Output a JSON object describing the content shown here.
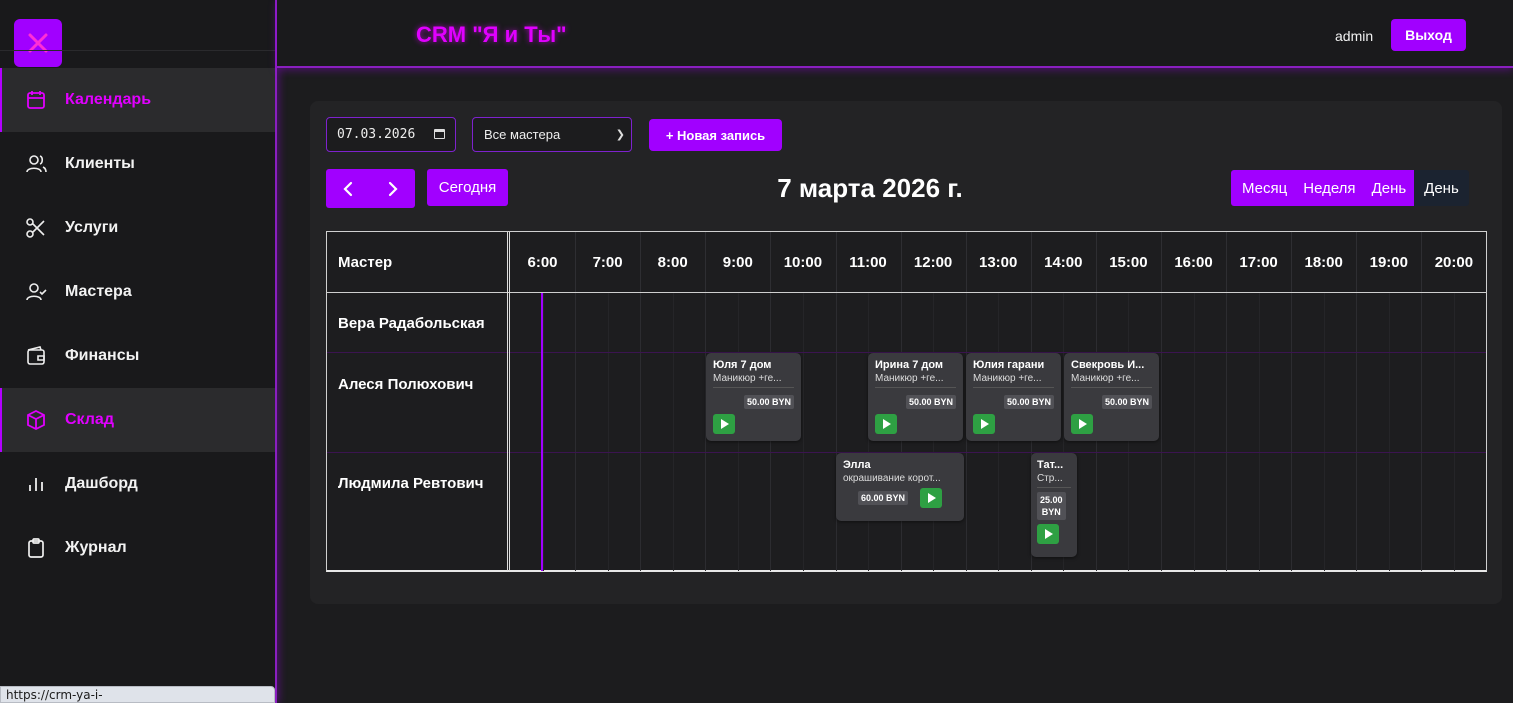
{
  "app": {
    "brand": "CRM \"Я и Ты\""
  },
  "header": {
    "user": "admin",
    "logout_label": "Выход"
  },
  "sidebar": {
    "items": [
      {
        "label": "Календарь",
        "icon": "calendar-icon",
        "state": "active"
      },
      {
        "label": "Клиенты",
        "icon": "users-icon",
        "state": "normal"
      },
      {
        "label": "Услуги",
        "icon": "scissors-icon",
        "state": "normal"
      },
      {
        "label": "Мастера",
        "icon": "user-check-icon",
        "state": "normal"
      },
      {
        "label": "Финансы",
        "icon": "wallet-icon",
        "state": "normal"
      },
      {
        "label": "Склад",
        "icon": "box-icon",
        "state": "hover"
      },
      {
        "label": "Дашборд",
        "icon": "bar-chart-icon",
        "state": "normal"
      },
      {
        "label": "Журнал",
        "icon": "clipboard-icon",
        "state": "normal"
      }
    ],
    "status_url": "https://crm-ya-i-ty.up.railway.app/warehouse"
  },
  "filters": {
    "date_value": "07.03.2026",
    "master_selected": "Все мастера",
    "new_label": "+ Новая запись"
  },
  "calendar": {
    "today_label": "Сегодня",
    "title": "7 марта 2026 г.",
    "views": [
      "Месяц",
      "Неделя",
      "День",
      "День"
    ],
    "active_view": "День",
    "master_header": "Мастер",
    "hours": [
      "6:00",
      "7:00",
      "8:00",
      "9:00",
      "10:00",
      "11:00",
      "12:00",
      "13:00",
      "14:00",
      "15:00",
      "16:00",
      "17:00",
      "18:00",
      "19:00",
      "20:00"
    ],
    "masters": [
      "Вера Радабольская",
      "Алеся Полюхович",
      "Людмила Ревтович"
    ]
  },
  "appointments": [
    {
      "name": "Юля 7 дом",
      "service": "Маникюр +ге...",
      "price": "50.00 BYN"
    },
    {
      "name": "Ирина 7 дом",
      "service": "Маникюр +ге...",
      "price": "50.00 BYN"
    },
    {
      "name": "Юлия гарани",
      "service": "Маникюр +ге...",
      "price": "50.00 BYN"
    },
    {
      "name": "Свекровь И...",
      "service": "Маникюр +ге...",
      "price": "50.00 BYN"
    },
    {
      "name": "Элла",
      "service": "окрашивание корот...",
      "price": "60.00 BYN"
    },
    {
      "name": "Тат...",
      "service": "Стр...",
      "price_line1": "25.00",
      "price_line2": "BYN"
    }
  ],
  "colors": {
    "accent": "#a100ff",
    "brand_glow": "#e000ff",
    "play": "#2ea043",
    "background": "#1c1c1e"
  }
}
